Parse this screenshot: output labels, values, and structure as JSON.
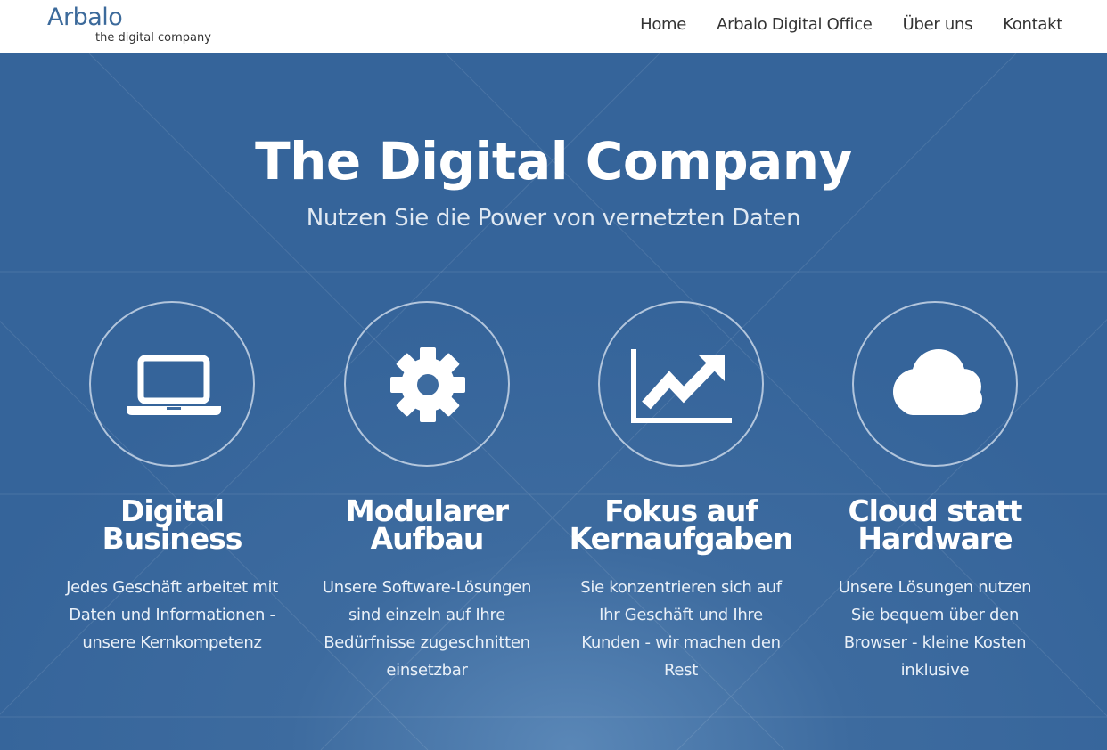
{
  "header": {
    "logo_name": "Arbalo",
    "logo_tagline": "the digital company",
    "nav": [
      "Home",
      "Arbalo Digital Office",
      "Über uns",
      "Kontakt"
    ]
  },
  "hero": {
    "title": "The Digital Company",
    "subtitle": "Nutzen Sie die Power von vernetzten Daten"
  },
  "features": [
    {
      "icon": "laptop-icon",
      "title_line1": "Digital",
      "title_line2": "Business",
      "text": "Jedes Geschäft arbeitet mit Daten und Informationen - unsere Kernkompetenz"
    },
    {
      "icon": "gear-icon",
      "title_line1": "Modularer",
      "title_line2": "Aufbau",
      "text": "Unsere Software-Lösungen sind einzeln auf Ihre Bedürfnisse zugeschnitten einsetzbar"
    },
    {
      "icon": "trending-chart-icon",
      "title_line1": "Fokus auf",
      "title_line2": "Kernaufgaben",
      "text": "Sie konzentrieren sich auf Ihr Geschäft und Ihre Kunden - wir machen den Rest"
    },
    {
      "icon": "cloud-icon",
      "title_line1": "Cloud statt",
      "title_line2": "Hardware",
      "text": "Unsere Lösungen nutzen Sie bequem über den Browser - kleine Kosten inklusive"
    }
  ],
  "colors": {
    "brand": "#3c6a9b",
    "hero_background": "#3d6b9f",
    "text_light": "#ffffff"
  }
}
